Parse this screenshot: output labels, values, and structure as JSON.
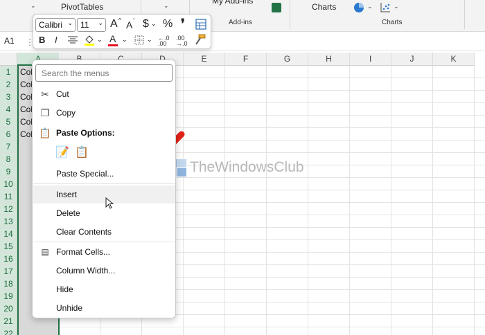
{
  "ribbon": {
    "pivot_label": "PivotTables",
    "addins_label": "My Add-ins",
    "addins_group": "Add-ins",
    "charts_label": "Charts",
    "charts_group": "Charts"
  },
  "formula_bar": {
    "name_box": "A1",
    "dots": "⋮"
  },
  "mini_toolbar": {
    "font_name": "Calibri",
    "font_size": "11",
    "bold": "B",
    "italic": "I",
    "font_color_letter": "A",
    "grow_font": "A",
    "shrink_font": "A",
    "currency": "$",
    "percent": "%",
    "comma": "❜",
    "colors": {
      "highlight": "#ffff00",
      "font": "#e81123"
    }
  },
  "grid": {
    "columns": [
      "A",
      "B",
      "C",
      "D",
      "E",
      "F",
      "G",
      "H",
      "I",
      "J",
      "K"
    ],
    "rows": [
      "1",
      "2",
      "3",
      "4",
      "5",
      "6",
      "7",
      "8",
      "9",
      "10",
      "11",
      "12",
      "13",
      "14",
      "15",
      "16",
      "17",
      "18",
      "19",
      "20",
      "21",
      "22"
    ],
    "cells_a": [
      "Col",
      "Col",
      "Col",
      "Col",
      "Col",
      "Col"
    ]
  },
  "context_menu": {
    "search_placeholder": "Search the menus",
    "items": {
      "cut": "Cut",
      "copy": "Copy",
      "paste_options": "Paste Options:",
      "paste_special": "Paste Special...",
      "insert": "Insert",
      "delete": "Delete",
      "clear_contents": "Clear Contents",
      "format_cells": "Format Cells...",
      "column_width": "Column Width...",
      "hide": "Hide",
      "unhide": "Unhide"
    }
  },
  "watermark": {
    "text": "TheWindowsClub"
  },
  "colors": {
    "accent": "#217346",
    "arrow": "#e2231a"
  }
}
